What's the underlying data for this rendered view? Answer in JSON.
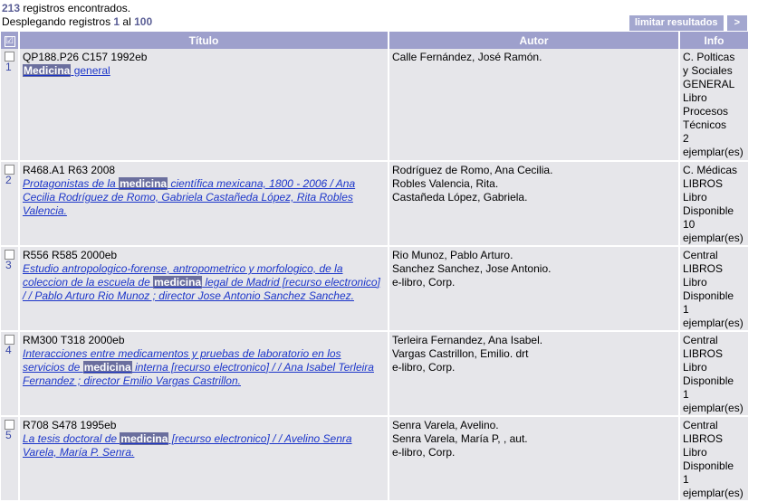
{
  "summary": {
    "count": "213",
    "count_suffix": " registros encontrados.",
    "showing_prefix": "Desplegando registros ",
    "from": "1",
    "middle": " al ",
    "to": "100"
  },
  "actions": {
    "limit_label": "limitar resultados",
    "next_label": ">"
  },
  "columns": {
    "check_icon": "☑",
    "title": "Título",
    "author": "Autor",
    "info": "Info"
  },
  "rows": [
    {
      "num": "1",
      "call": "QP188.P26 C157 1992eb",
      "title_pre": "",
      "title_hl": "Medicina",
      "title_post": " general",
      "authors": [
        "Calle Fernández, José Ramón.",
        "",
        ""
      ],
      "info": [
        "C. Polticas",
        "y Sociales",
        "GENERAL",
        "Libro",
        "Procesos",
        "Técnicos",
        "2",
        "ejemplar(es)"
      ]
    },
    {
      "num": "2",
      "call": "R468.A1 R63 2008",
      "title_pre": "Protagonistas de la ",
      "title_hl": "medicina",
      "title_post": " científica mexicana, 1800 - 2006 / Ana Cecilia Rodríguez de Romo, Gabriela Castañeda López, Rita Robles Valencia.",
      "authors": [
        "Rodríguez de Romo, Ana Cecilia.",
        "Robles Valencia, Rita.",
        "Castañeda López, Gabriela."
      ],
      "info": [
        "C. Médicas",
        "LIBROS",
        "Libro",
        "Disponible",
        "10",
        "ejemplar(es)"
      ]
    },
    {
      "num": "3",
      "call": "R556 R585 2000eb",
      "title_pre": "Estudio antropologico-forense, antropometrico y morfologico, de la coleccion de la escuela de ",
      "title_hl": "medicina",
      "title_post": " legal de Madrid [recurso electronico] / / Pablo Arturo Rio Munoz ; director Jose Antonio Sanchez Sanchez.",
      "authors": [
        "Rio Munoz, Pablo Arturo.",
        "Sanchez Sanchez, Jose Antonio.",
        "e-libro, Corp."
      ],
      "info": [
        "Central",
        "LIBROS",
        "Libro",
        "Disponible",
        "1",
        "ejemplar(es)"
      ]
    },
    {
      "num": "4",
      "call": "RM300 T318 2000eb",
      "title_pre": "Interacciones entre medicamentos y pruebas de laboratorio en los servicios de ",
      "title_hl": "medicina",
      "title_post": " interna [recurso electronico] / / Ana Isabel Terleira Fernandez ; director Emilio Vargas Castrillon.",
      "authors": [
        "Terleira Fernandez, Ana Isabel.",
        "Vargas Castrillon, Emilio. drt",
        "e-libro, Corp."
      ],
      "info": [
        "Central",
        "LIBROS",
        "Libro",
        "Disponible",
        "1",
        "ejemplar(es)"
      ]
    },
    {
      "num": "5",
      "call": "R708 S478 1995eb",
      "title_pre": "La tesis doctoral de ",
      "title_hl": "medicina",
      "title_post": " [recurso electronico] / / Avelino Senra Varela, María P. Senra.",
      "authors": [
        "Senra Varela, Avelino.",
        "Senra Varela, María P, , aut.",
        "e-libro, Corp."
      ],
      "info": [
        "Central",
        "LIBROS",
        "Libro",
        "Disponible",
        "1",
        "ejemplar(es)"
      ]
    }
  ]
}
